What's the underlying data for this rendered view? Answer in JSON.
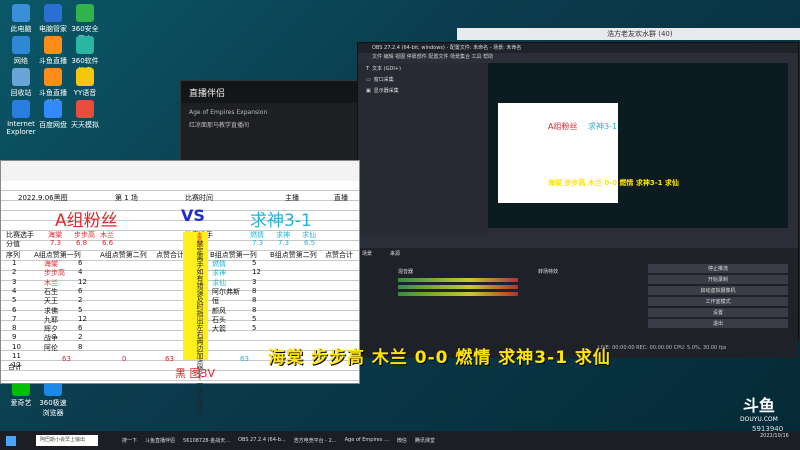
{
  "desktop": {
    "icons": [
      {
        "label": "此电脑",
        "color": "#3b8fd8"
      },
      {
        "label": "电脑管家",
        "color": "#2b6fd3"
      },
      {
        "label": "360安全卫士",
        "color": "#30b34a"
      },
      {
        "label": "网络",
        "color": "#2e88d3"
      },
      {
        "label": "斗鱼直播",
        "color": "#ff8c1a"
      },
      {
        "label": "360软件管家",
        "color": "#2bb5a3"
      },
      {
        "label": "回收站",
        "color": "#6aa4d8"
      },
      {
        "label": "斗鱼直播伴侣",
        "color": "#ff8c1a"
      },
      {
        "label": "YY语音",
        "color": "#f5c60e"
      },
      {
        "label": "Internet Explorer",
        "color": "#2a7de0"
      },
      {
        "label": "百度网盘",
        "color": "#3388ff"
      },
      {
        "label": "天天模拟",
        "color": "#e94c3a"
      },
      {
        "label": "爱奇艺",
        "color": "#00be06"
      },
      {
        "label": "360极速浏览器",
        "color": "#1a8ae6"
      }
    ]
  },
  "studio": {
    "title": "直播伴侣",
    "line1": "Age of Empires Expansion",
    "line2": "红凉面那马教学直播间"
  },
  "qq": {
    "title": "浩方老友欢水群 (40)"
  },
  "obs": {
    "title": "OBS 27.2.4 (64-bit, windows) - 配置文件: 未命名 - 场景: 未命名",
    "menu": "文件  编辑  视图  停靠部件  配置文件  场景集合  工具  帮助",
    "sources": [
      "文本 (GDI+)",
      "窗口采集",
      "显示器采集"
    ],
    "panels": [
      "场景",
      "来源",
      "混音器",
      "转场特效",
      "控件"
    ],
    "controls": [
      "停止推流",
      "开始录制",
      "启动虚拟摄像机",
      "工作室模式",
      "设置",
      "退出"
    ],
    "status": "LIVE: 00:00:00   REC: 00:00:00   CPU: 5.0%, 30.00 fps"
  },
  "sheet": {
    "title": "2022.9.06黑图",
    "round": "第    1    场",
    "match": "比赛时间",
    "host": "主播",
    "live": "直播",
    "teamA": "A组粉丝",
    "vs": "VS",
    "teamB": "求神3-1",
    "row_player": "比赛选手",
    "row_score": "分值",
    "aPlayers": [
      "海棠",
      "步步高",
      "木兰"
    ],
    "aScores": [
      "7.3",
      "6.8",
      "6.6"
    ],
    "bPlayers": [
      "燃情",
      "求神",
      "求仙"
    ],
    "bScores": [
      "7.3",
      "7.3",
      "6.5"
    ],
    "hdr": [
      "序列",
      "A组点赞第一列",
      "A组点赞第二列",
      "点赞合计"
    ],
    "hdrB": [
      "B组点赞第一列",
      "B组点赞第二列",
      "点赞合计"
    ],
    "rowsA": [
      [
        "1",
        "海棠",
        "6"
      ],
      [
        "2",
        "步步高",
        "4"
      ],
      [
        "3",
        "木兰",
        "12"
      ],
      [
        "4",
        "石生",
        "6"
      ],
      [
        "5",
        "天王",
        "2"
      ],
      [
        "6",
        "求佛",
        "5"
      ],
      [
        "7",
        "九耶",
        "12"
      ],
      [
        "8",
        "辉夕",
        "6"
      ],
      [
        "9",
        "战争",
        "2"
      ],
      [
        "10",
        "阿伦",
        "8"
      ],
      [
        "11",
        "",
        ""
      ],
      [
        "12",
        "",
        ""
      ]
    ],
    "rowsB": [
      [
        "燃情",
        "5"
      ],
      [
        "求神",
        "12"
      ],
      [
        "求仙",
        "3"
      ],
      [
        "阿尔弗斯",
        "8"
      ],
      [
        "恒",
        "8"
      ],
      [
        "颜风",
        "8"
      ],
      [
        "石头",
        "5"
      ],
      [
        "大箭",
        "5"
      ]
    ],
    "vertical": "禁定离手如有错误及时指出左右两边加点赞不一讲入排队",
    "sideRed": "击赏比",
    "total_label": "合计",
    "totals": [
      "63",
      "0",
      "63",
      "63"
    ],
    "map": "黑 图3V"
  },
  "overlay": {
    "text": "海棠 步步高 木兰 0-0 燃情 求神3-1 求仙"
  },
  "taskbar": {
    "search": "阿巴斯小会早上输出",
    "items": [
      "搜一下",
      "斗鱼直播伴侣",
      "56108728-金战天...",
      "OBS 27.2.4 (64-b...",
      "浩方电竞平台 - 2...",
      "Age of Empires ...",
      "微信",
      "腾讯课堂"
    ],
    "time": "2022/10/16"
  },
  "douyu": {
    "logo": "斗鱼",
    "site": "DOUYU.COM",
    "room": "5913940"
  }
}
